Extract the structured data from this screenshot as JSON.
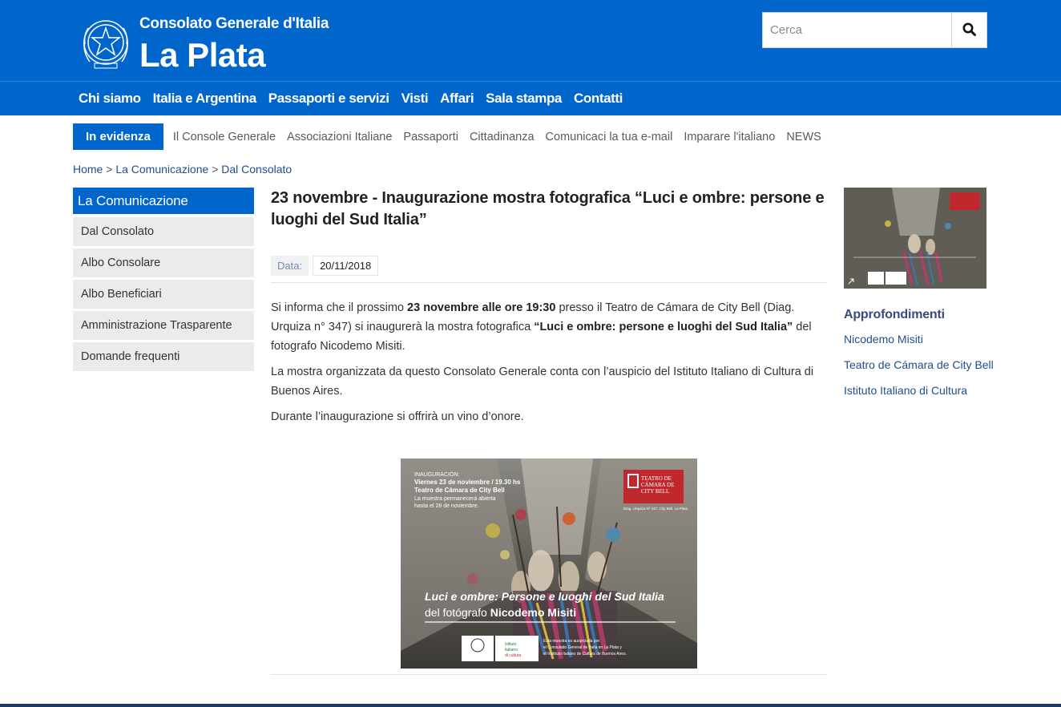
{
  "header": {
    "subtitle": "Consolato Generale d'Italia",
    "title": "La Plata",
    "search_placeholder": "Cerca",
    "search_icon": "search-icon"
  },
  "main_nav": [
    {
      "label": "Chi siamo"
    },
    {
      "label": "Italia e Argentina"
    },
    {
      "label": "Passaporti e servizi"
    },
    {
      "label": "Visti"
    },
    {
      "label": "Affari"
    },
    {
      "label": "Sala stampa"
    },
    {
      "label": "Contatti"
    }
  ],
  "sub_nav": {
    "highlight": "In evidenza",
    "items": [
      {
        "label": "Il Console Generale"
      },
      {
        "label": "Associazioni Italiane"
      },
      {
        "label": "Passaporti"
      },
      {
        "label": "Cittadinanza"
      },
      {
        "label": "Comunicaci la tua e-mail"
      },
      {
        "label": "Imparare l'italiano"
      },
      {
        "label": "NEWS"
      }
    ]
  },
  "breadcrumb": {
    "items": [
      "Home",
      "La Comunicazione",
      "Dal Consolato"
    ],
    "separator": ">"
  },
  "left_sidebar": {
    "title": "La Comunicazione",
    "items": [
      {
        "label": "Dal Consolato"
      },
      {
        "label": "Albo Consolare"
      },
      {
        "label": "Albo Beneficiari"
      },
      {
        "label": "Amministrazione Trasparente"
      },
      {
        "label": "Domande frequenti"
      }
    ]
  },
  "article": {
    "title": "23 novembre - Inaugurazione mostra fotografica “Luci e ombre: persone e luoghi del Sud Italia”",
    "date_label": "Data:",
    "date_value": "20/11/2018",
    "p1_a": "Si informa che il prossimo ",
    "p1_b": "23 novembre alle ore 19:30",
    "p1_c": " presso il Teatro de Cámara de City Bell (Diag. Urquiza n° 347) si inaugurerà la mostra fotografica ",
    "p1_d": "“Luci e ombre: persone e luoghi del Sud Italia”",
    "p1_e": " del fotografo Nicodemo Misiti.",
    "p2": "La mostra organizzata da questo Consolato Generale conta con l’auspicio del Istituto Italiano di Cultura di Buenos Aires.",
    "p3": "Durante l’inaugurazione si offrirà un vino d’onore."
  },
  "poster": {
    "inaug": "INAUGURACIÓN:",
    "line1": "Viernes 23 de noviembre  / 19.30 hs",
    "line2": "Teatro de Cámara de City Bell",
    "line3": "La muestra permanecerá abierta",
    "line4": "hasta el 28 de noviembre.",
    "teatro1": "TEATRO DE",
    "teatro2": "CÁMARA DE",
    "teatro3": "CITY BELL",
    "teatro_addr": "Diag. Urquiza Nº 347. City Bell. La Plata",
    "title_line": "Luci e ombre: Persone e luoghi del Sud Italia",
    "author_prefix": "del fotógrafo ",
    "author_name": "Nicodemo Misiti",
    "istituto1": "istituto",
    "istituto2": "italiano",
    "istituto3": "di cultura",
    "credit1": "Esta muestra es auspiciada por:",
    "credit2": "el Consulado General de Italia en La Plata y",
    "credit3": "el Instituto Italiano de Cultura de Buenos Aires."
  },
  "right_sidebar": {
    "title": "Approfondimenti",
    "links": [
      {
        "label": "Nicodemo Misiti"
      },
      {
        "label": "Teatro de Cámara de City Bell"
      },
      {
        "label": "Istituto Italiano di Cultura"
      }
    ]
  },
  "colors": {
    "brand_blue": "#0066cc",
    "link_blue": "#1f4e8c",
    "sidebar_bg": "#ebebeb"
  }
}
